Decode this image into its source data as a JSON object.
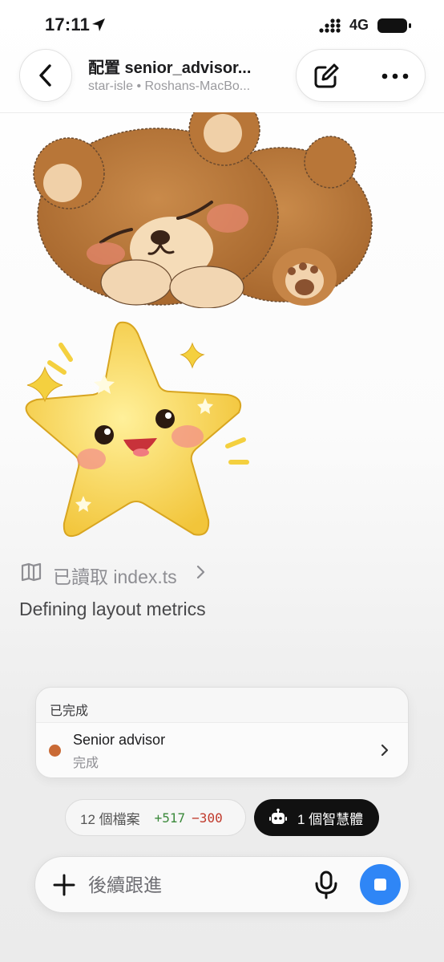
{
  "status_bar": {
    "time": "17:11",
    "network": "4G"
  },
  "header": {
    "title": "配置 senior_advisor...",
    "subtitle": "star-isle • Roshans-MacBo..."
  },
  "messages": {
    "stickers": [
      "sleeping-bear-sticker",
      "happy-star-sticker"
    ],
    "read_file": "已讀取 index.ts",
    "status": "Defining layout metrics"
  },
  "completion_card": {
    "header": "已完成",
    "agent_name": "Senior advisor",
    "agent_status": "完成",
    "agent_color": "#c96a35"
  },
  "chips": {
    "files": "12 個檔案",
    "additions": "+517",
    "deletions": "−300",
    "agents": "1 個智慧體"
  },
  "composer": {
    "placeholder": "後續跟進"
  },
  "colors": {
    "accent": "#2f86f6",
    "additions": "#3c8a3c",
    "deletions": "#c0392b"
  }
}
